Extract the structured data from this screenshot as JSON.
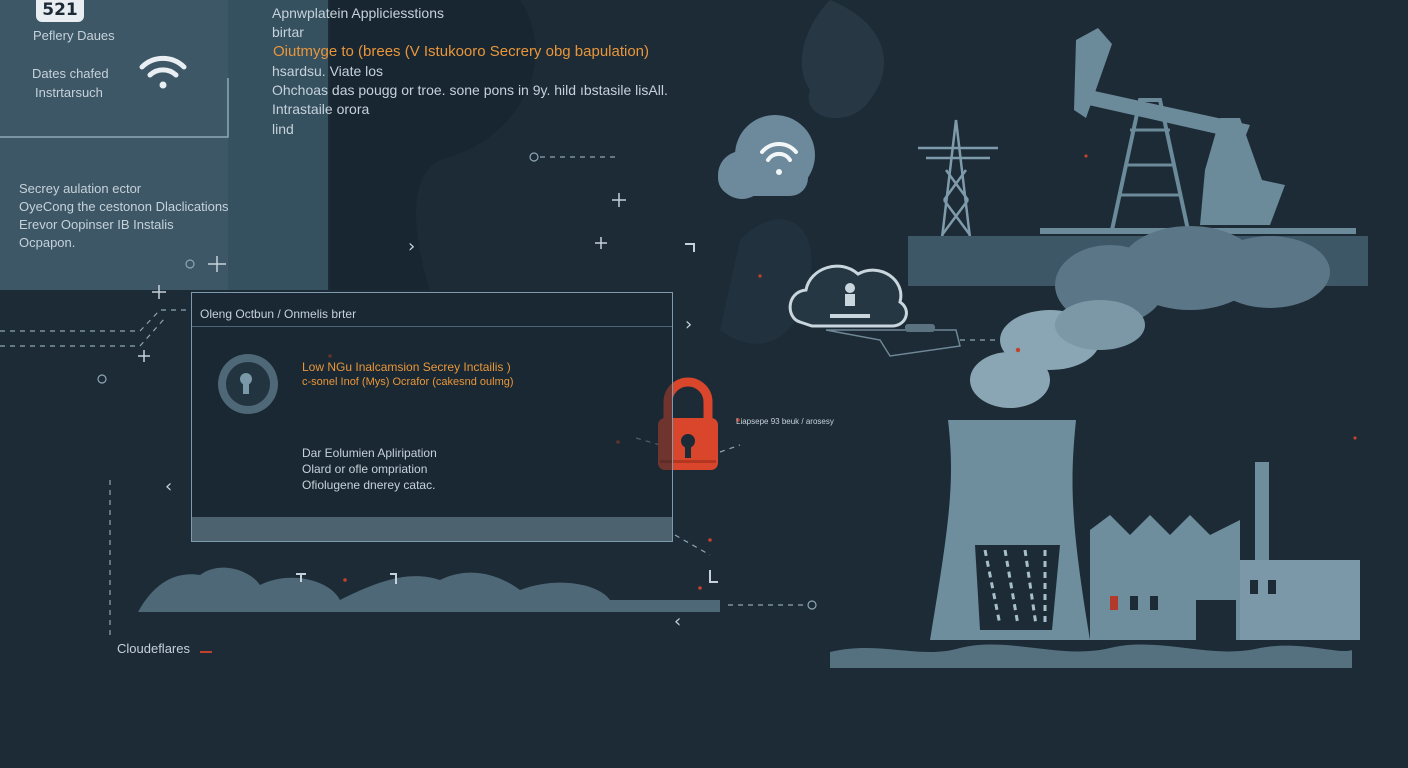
{
  "badge": {
    "text": "521"
  },
  "top_left": {
    "title": "Peflery Daues",
    "desc_line1": "Dates chafed",
    "desc_line2": "Instrtarsuch"
  },
  "top_text": {
    "line1": "Apnwplatein Appliciesstions",
    "line2": "birtar",
    "highlight": "Oiutmyge to (brees (V Istukooro Secrery obg bapulation)",
    "line4": "hsardsu. Viate los",
    "line5": "Ohchoas das pougg or troe. sone pons in 9y. hild ıbstasile lisAll.",
    "line6": "Intrastaile orora",
    "line7": "lind"
  },
  "side_text": {
    "line1": "Secrey aulation ector",
    "line2": "OyeCong the cestonon Dlaclications",
    "line3": "Erevor Oopinser IB Instalis",
    "line4": "Ocpapon."
  },
  "card": {
    "header": "Oleng Octbun / Onmelis brter",
    "alert_line1": "Low NGu Inalcamsion Secrey Inctailis )",
    "alert_line2": "c-sonel Inof (Mys) Ocrafor (cakesnd oulmg)",
    "body_line1": "Dar Eolumien Apliripation",
    "body_line2": "Olard or ofle ompriation",
    "body_line3": "Ofiolugene dnerey catac."
  },
  "lock_label": "Liapsepe 93 beuk / arosesy",
  "bottom_label": "Cloudeflares",
  "colors": {
    "background": "#1c2b36",
    "panel": "#4e6877",
    "accent": "#e9963a",
    "lock": "#d9462c",
    "silhouette": "#6e8e9e"
  },
  "icons": [
    "wifi-icon",
    "cloud-wifi-icon",
    "cloud-upload-icon",
    "keyhole-icon",
    "padlock-icon"
  ]
}
